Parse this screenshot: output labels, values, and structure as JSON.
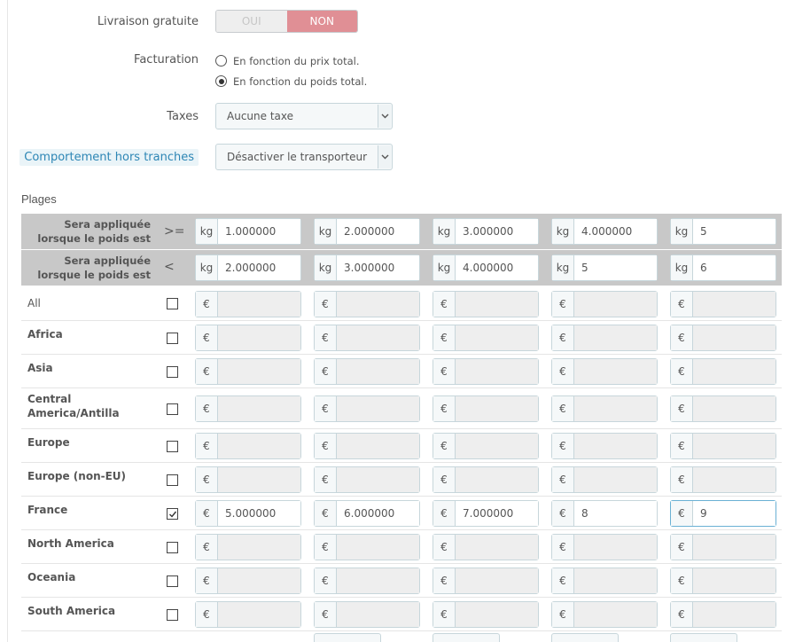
{
  "form": {
    "free_shipping": {
      "label": "Livraison gratuite",
      "yes": "OUI",
      "no": "NON",
      "selected": "NON"
    },
    "billing": {
      "label": "Facturation",
      "options": [
        "En fonction du prix total.",
        "En fonction du poids total."
      ],
      "selected_index": 1
    },
    "taxes": {
      "label": "Taxes",
      "value": "Aucune taxe"
    },
    "out_of_range": {
      "label": "Comportement hors tranches",
      "value": "Désactiver le transporteur"
    }
  },
  "ranges": {
    "title": "Plages",
    "applied_label": "Sera appliquée lorsque le poids est",
    "op_ge": ">=",
    "op_lt": "<",
    "unit": "kg",
    "currency": "€",
    "from": [
      "1.000000",
      "2.000000",
      "3.000000",
      "4.000000",
      "5"
    ],
    "to": [
      "2.000000",
      "3.000000",
      "4.000000",
      "5",
      "6"
    ]
  },
  "zones": [
    {
      "name": "All",
      "checked": false,
      "prices": [
        "",
        "",
        "",
        "",
        ""
      ]
    },
    {
      "name": "Africa",
      "checked": false,
      "prices": [
        "",
        "",
        "",
        "",
        ""
      ]
    },
    {
      "name": "Asia",
      "checked": false,
      "prices": [
        "",
        "",
        "",
        "",
        ""
      ]
    },
    {
      "name": "Central America/Antilla",
      "checked": false,
      "prices": [
        "",
        "",
        "",
        "",
        ""
      ]
    },
    {
      "name": "Europe",
      "checked": false,
      "prices": [
        "",
        "",
        "",
        "",
        ""
      ]
    },
    {
      "name": "Europe (non-EU)",
      "checked": false,
      "prices": [
        "",
        "",
        "",
        "",
        ""
      ]
    },
    {
      "name": "France",
      "checked": true,
      "prices": [
        "5.000000",
        "6.000000",
        "7.000000",
        "8",
        "9"
      ]
    },
    {
      "name": "North America",
      "checked": false,
      "prices": [
        "",
        "",
        "",
        "",
        ""
      ]
    },
    {
      "name": "Oceania",
      "checked": false,
      "prices": [
        "",
        "",
        "",
        "",
        ""
      ]
    },
    {
      "name": "South America",
      "checked": false,
      "prices": [
        "",
        "",
        "",
        "",
        ""
      ]
    }
  ]
}
